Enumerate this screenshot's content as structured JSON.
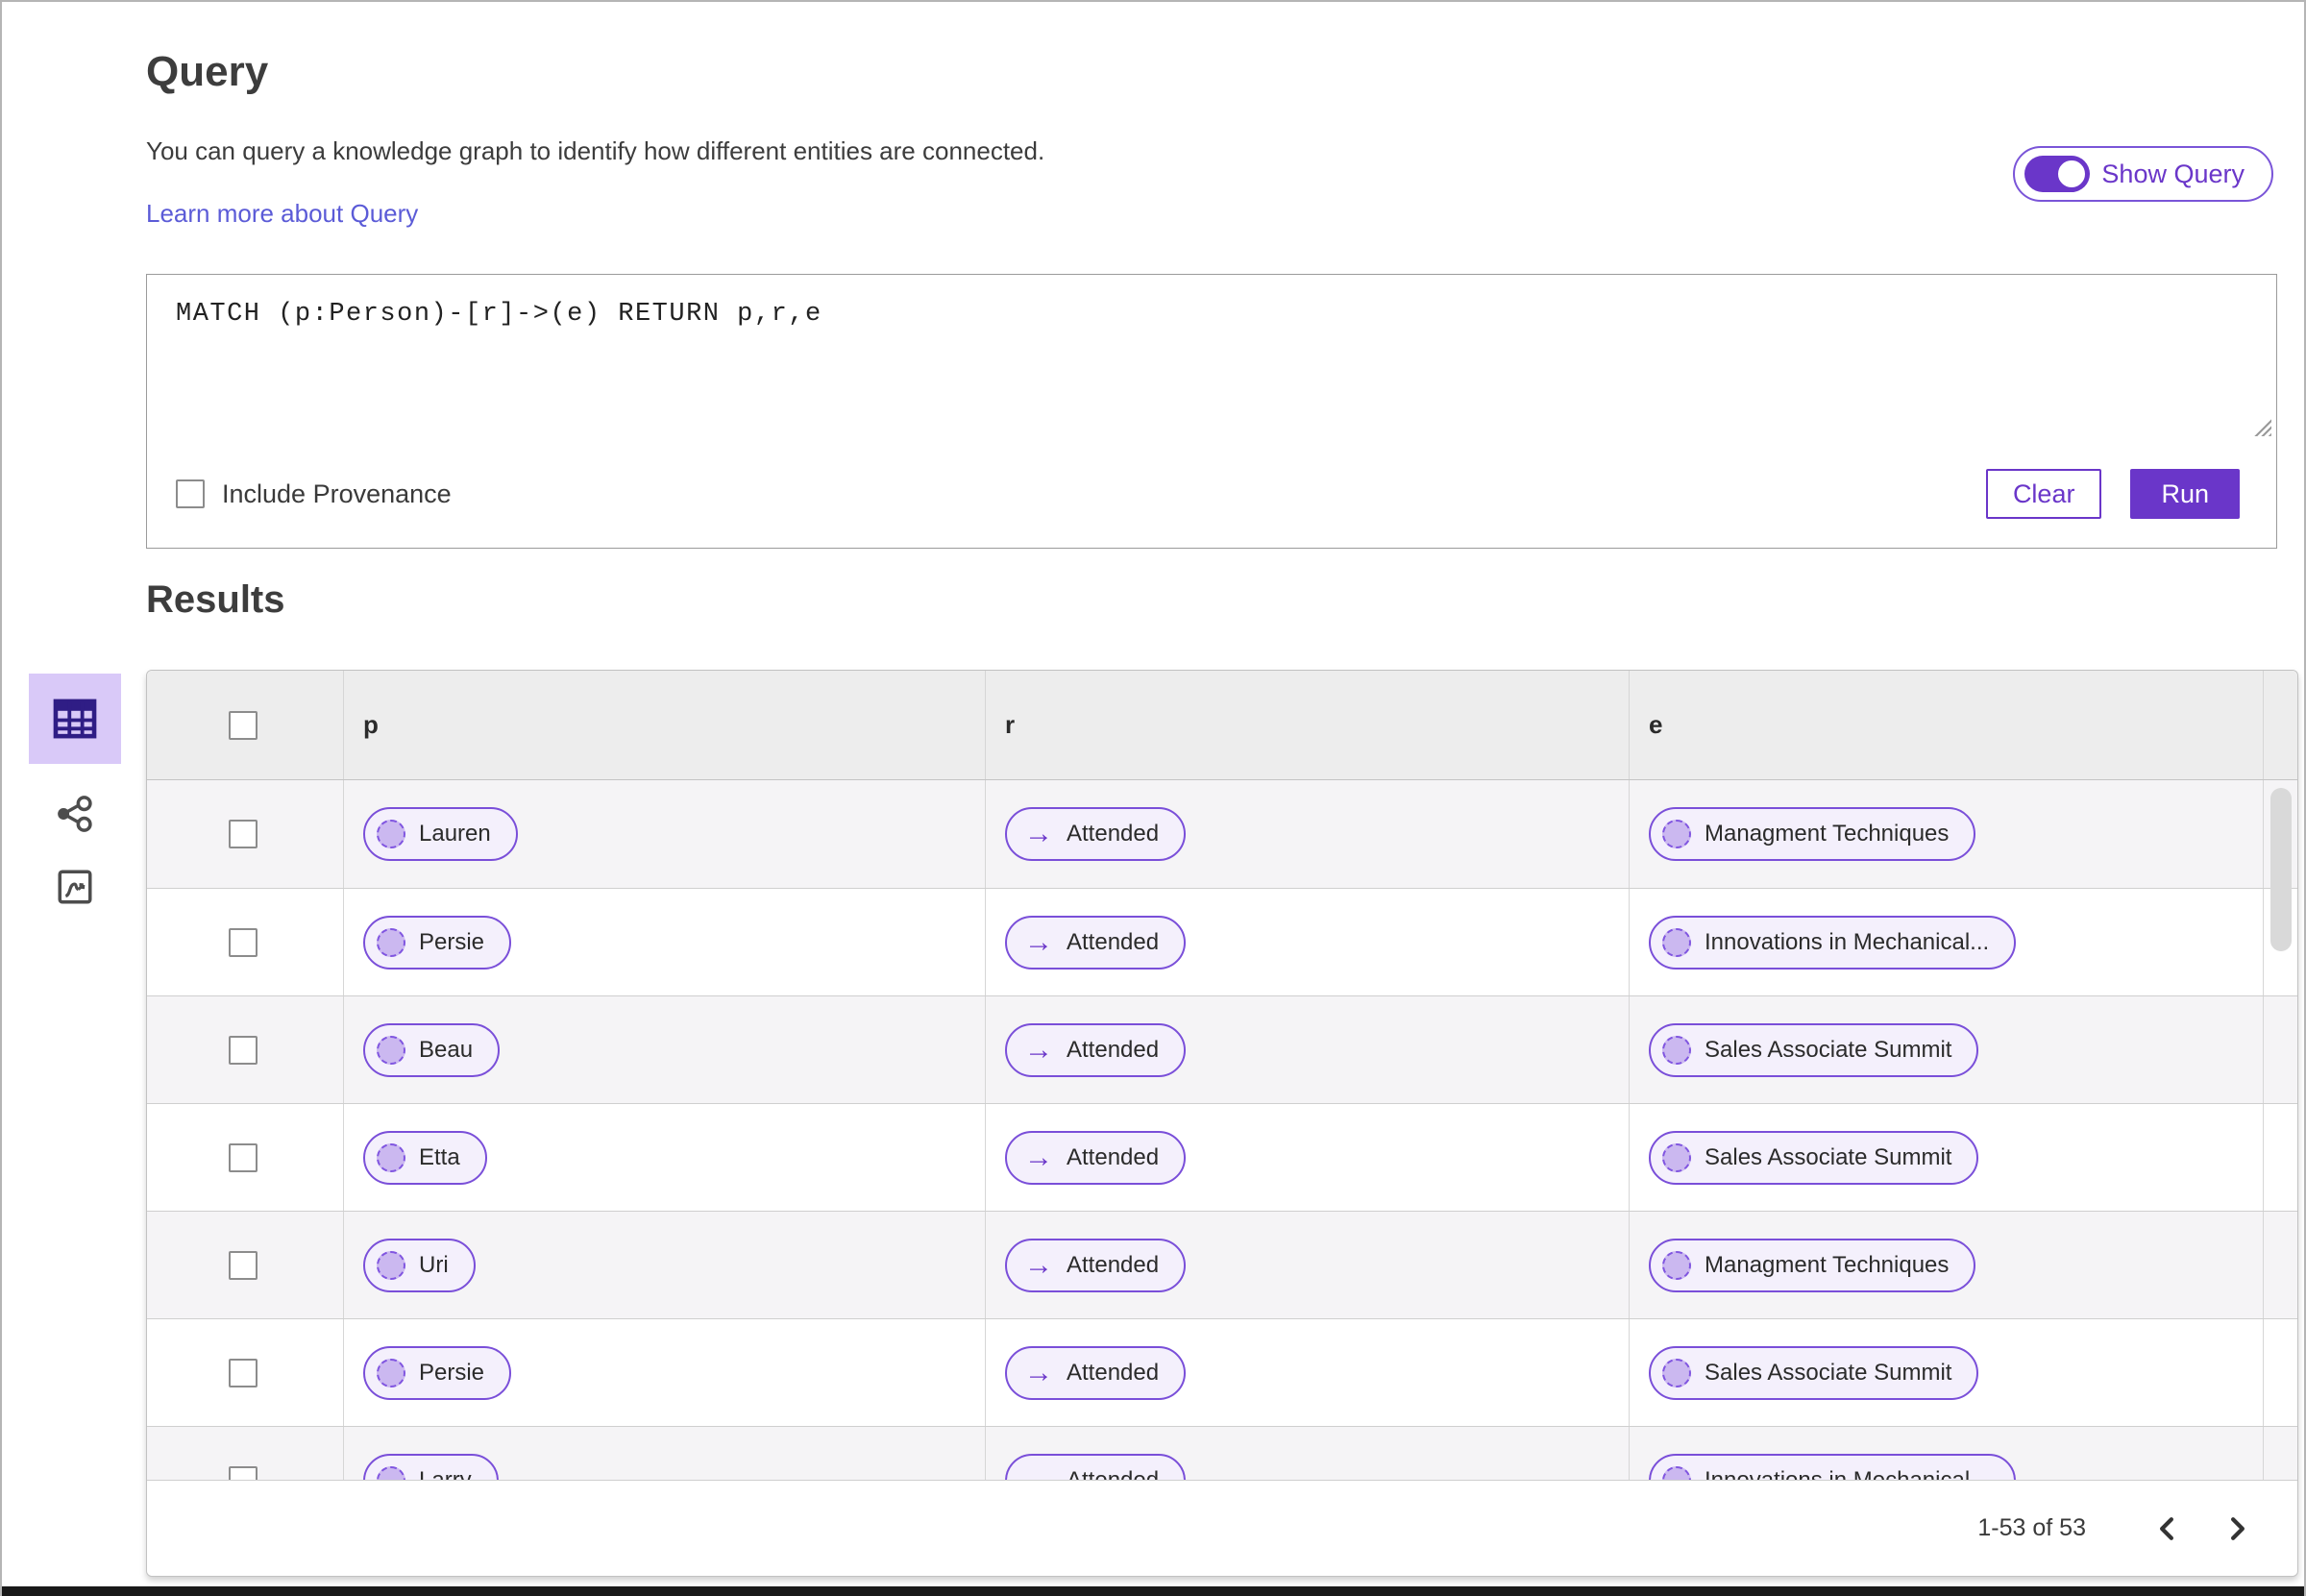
{
  "header": {
    "title": "Query",
    "description": "You can query a knowledge graph to identify how different entities are connected.",
    "learn_more_link": "Learn more about Query",
    "show_query_toggle": {
      "label": "Show Query",
      "state": "on"
    }
  },
  "query_editor": {
    "query_text": "MATCH (p:Person)-[r]->(e) RETURN p,r,e",
    "include_provenance": {
      "label": "Include Provenance",
      "checked": false
    },
    "buttons": {
      "clear": "Clear",
      "run": "Run"
    }
  },
  "results": {
    "heading": "Results",
    "view_switcher": [
      {
        "icon": "table-view-icon",
        "selected": true
      },
      {
        "icon": "graph-view-icon",
        "selected": false
      },
      {
        "icon": "map-view-icon",
        "selected": false
      }
    ],
    "table": {
      "columns": [
        "p",
        "r",
        "e"
      ],
      "rows": [
        {
          "p": "Lauren",
          "r": "Attended",
          "e": "Managment Techniques"
        },
        {
          "p": "Persie",
          "r": "Attended",
          "e": "Innovations in Mechanical..."
        },
        {
          "p": "Beau",
          "r": "Attended",
          "e": "Sales Associate Summit"
        },
        {
          "p": "Etta",
          "r": "Attended",
          "e": "Sales Associate Summit"
        },
        {
          "p": "Uri",
          "r": "Attended",
          "e": "Managment Techniques"
        },
        {
          "p": "Persie",
          "r": "Attended",
          "e": "Sales Associate Summit"
        },
        {
          "p": "Larry",
          "r": "Attended",
          "e": "Innovations in Mechanical..."
        }
      ]
    },
    "pagination": {
      "range_label": "1-53 of 53"
    }
  },
  "icons": {
    "edge_arrow": "→"
  },
  "colors": {
    "accent_purple": "#6a36c9",
    "pill_border": "#7a4fd9",
    "node_fill": "#cbb8f0",
    "selected_tile_bg": "#d9c9f8",
    "link": "#5b5bd7",
    "header_row_bg": "#ededed",
    "stripe_row_bg": "#f5f4f6"
  }
}
